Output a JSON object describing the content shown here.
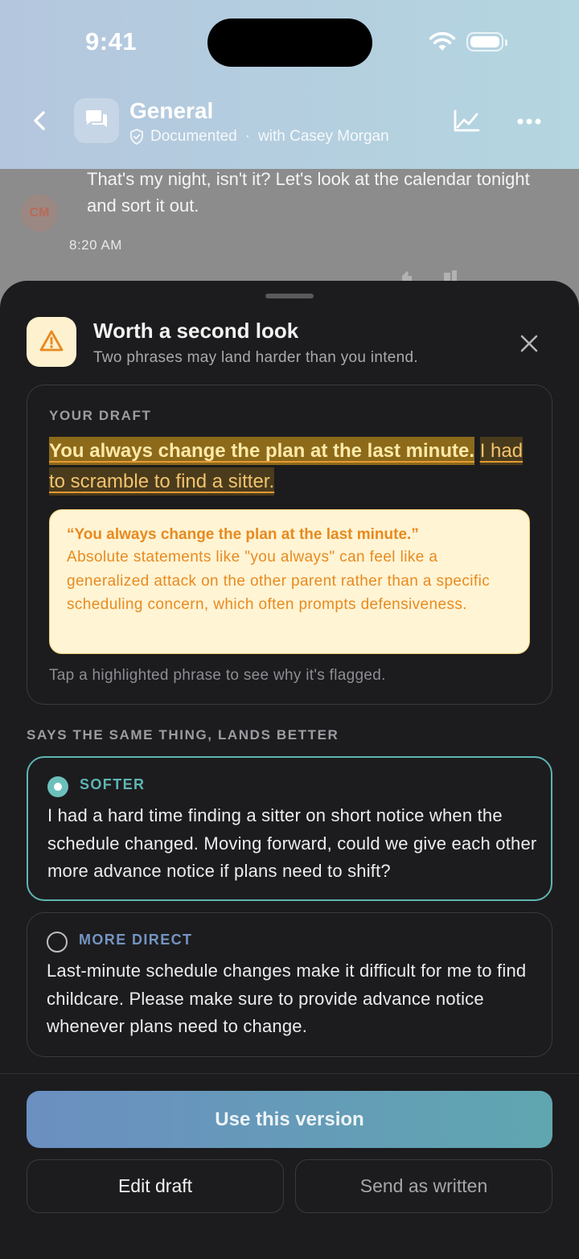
{
  "status_bar": {
    "time": "9:41"
  },
  "header": {
    "title": "General",
    "subtitle_status": "Documented",
    "subtitle_separator": "·",
    "subtitle_participant": "with Casey Morgan"
  },
  "chat": {
    "avatar_initials": "CM",
    "message": "That's my night, isn't it? Let's look at the calendar tonight and sort it out.",
    "timestamp": "8:20 AM"
  },
  "sheet": {
    "title": "Worth a second look",
    "subtitle": "Two phrases may land harder than you intend.",
    "draft": {
      "label": "YOUR DRAFT",
      "flagged_phrase_1": "You always change the plan at the last minute.",
      "flagged_phrase_2": "I had to scramble to find a sitter.",
      "explanation_quote": "“You always change the plan at the last minute.”",
      "explanation_text": "Absolute statements like \"you always\" can feel like a generalized attack on the other parent rather than a specific scheduling concern, which often prompts defensiveness.",
      "hint": "Tap a highlighted phrase to see why it's flagged."
    },
    "alternatives_label": "SAYS THE SAME THING, LANDS BETTER",
    "options": [
      {
        "tag": "SOFTER",
        "selected": true,
        "text": "I had a hard time finding a sitter on short notice when the schedule changed. Moving forward, could we give each other more advance notice if plans need to shift?"
      },
      {
        "tag": "MORE DIRECT",
        "selected": false,
        "text": "Last-minute schedule changes make it difficult for me to find childcare. Please make sure to provide advance notice whenever plans need to change."
      }
    ],
    "buttons": {
      "primary": "Use this version",
      "edit": "Edit draft",
      "send": "Send as written"
    }
  },
  "colors": {
    "accent_teal": "#5fb5b3",
    "accent_blue": "#7494c2",
    "warning_orange": "#e88a1f",
    "warning_bg": "#fff4d4",
    "sheet_bg": "#1c1c1e"
  },
  "icons": [
    "back-chevron-icon",
    "chat-bubbles-icon",
    "shield-check-icon",
    "trend-chart-icon",
    "more-dots-icon",
    "warning-triangle-icon",
    "close-icon",
    "wifi-icon",
    "battery-icon"
  ]
}
